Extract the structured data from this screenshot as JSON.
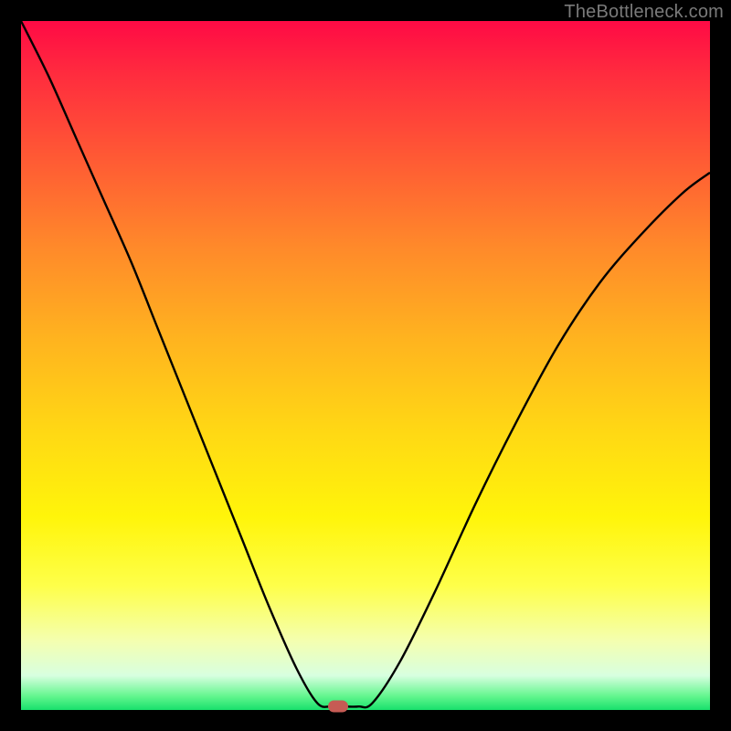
{
  "watermark": {
    "text": "TheBottleneck.com"
  },
  "chart_data": {
    "type": "line",
    "title": "",
    "xlabel": "",
    "ylabel": "",
    "xlim": [
      0,
      100
    ],
    "ylim": [
      0,
      100
    ],
    "grid": false,
    "legend": false,
    "series": [
      {
        "name": "bottleneck-curve",
        "x": [
          0,
          4,
          8,
          12,
          16,
          20,
          24,
          28,
          32,
          36,
          40,
          43,
          45,
          47,
          49,
          51,
          55,
          60,
          66,
          72,
          78,
          84,
          90,
          96,
          100
        ],
        "y": [
          100,
          92,
          83,
          74,
          65,
          55,
          45,
          35,
          25,
          15,
          6,
          1,
          0.5,
          0.5,
          0.5,
          1,
          7,
          17,
          30,
          42,
          53,
          62,
          69,
          75,
          78
        ]
      }
    ],
    "marker": {
      "x": 46,
      "y": 0.5,
      "color": "#c65b54"
    },
    "background_gradient": {
      "top": "#ff0a45",
      "bottom": "#18e06c"
    }
  }
}
